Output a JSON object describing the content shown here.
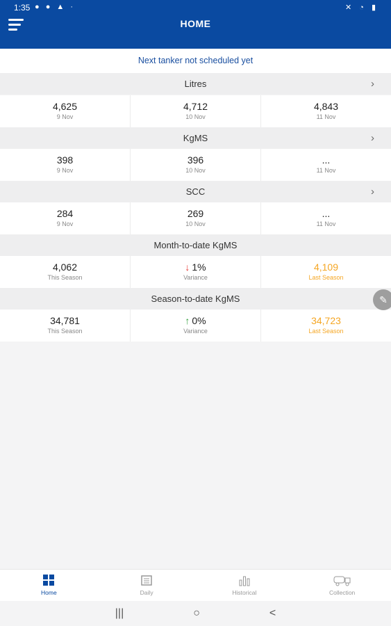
{
  "status": {
    "time": "1:35",
    "left_icons": "● ● ▲ ·",
    "right_icons": "✕ ◔ ▮"
  },
  "header": {
    "title": "HOME",
    "menu_icon": "menu-icon"
  },
  "notice": "Next tanker not scheduled yet",
  "sections": {
    "litres": {
      "title": "Litres",
      "cells": [
        {
          "value": "4,625",
          "label": "9 Nov"
        },
        {
          "value": "4,712",
          "label": "10 Nov"
        },
        {
          "value": "4,843",
          "label": "11 Nov"
        }
      ]
    },
    "kgms": {
      "title": "KgMS",
      "cells": [
        {
          "value": "398",
          "label": "9 Nov"
        },
        {
          "value": "396",
          "label": "10 Nov"
        },
        {
          "value": "...",
          "label": "11 Nov"
        }
      ]
    },
    "scc": {
      "title": "SCC",
      "cells": [
        {
          "value": "284",
          "label": "9 Nov"
        },
        {
          "value": "269",
          "label": "10 Nov"
        },
        {
          "value": "...",
          "label": "11 Nov"
        }
      ]
    },
    "mtd": {
      "title": "Month-to-date KgMS",
      "cells": [
        {
          "value": "4,062",
          "label": "This Season"
        },
        {
          "value": "1%",
          "label": "Variance",
          "arrow": "↓"
        },
        {
          "value": "4,109",
          "label": "Last Season"
        }
      ]
    },
    "std": {
      "title": "Season-to-date KgMS",
      "cells": [
        {
          "value": "34,781",
          "label": "This Season"
        },
        {
          "value": "0%",
          "label": "Variance",
          "arrow": "↑"
        },
        {
          "value": "34,723",
          "label": "Last Season"
        }
      ]
    }
  },
  "colors": {
    "primary": "#0a4aa1",
    "last_season": "#f5a623",
    "down": "#e53935",
    "up": "#2e9d3a"
  },
  "nav": [
    {
      "label": "Home",
      "icon": "grid-icon"
    },
    {
      "label": "Daily",
      "icon": "calendar-icon"
    },
    {
      "label": "Historical",
      "icon": "bar-chart-icon"
    },
    {
      "label": "Collection",
      "icon": "truck-icon"
    }
  ],
  "system_nav": {
    "recents": "|||",
    "home": "○",
    "back": "<"
  }
}
